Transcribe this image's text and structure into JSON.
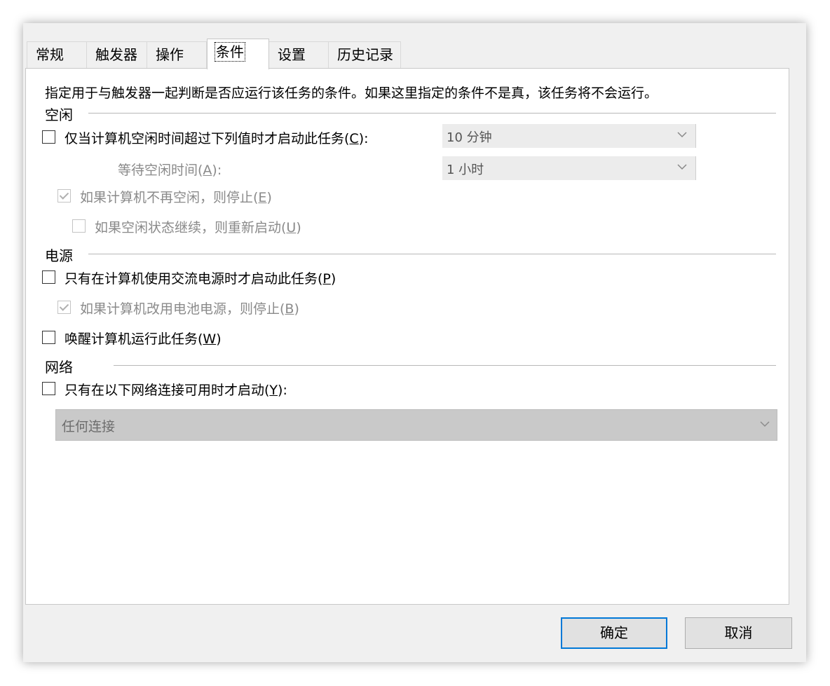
{
  "tabs": [
    {
      "label": "常规"
    },
    {
      "label": "触发器"
    },
    {
      "label": "操作"
    },
    {
      "label": "条件"
    },
    {
      "label": "设置"
    },
    {
      "label": "历史记录"
    }
  ],
  "active_tab": "条件",
  "description": "指定用于与触发器一起判断是否应运行该任务的条件。如果这里指定的条件不是真，该任务将不会运行。",
  "idle": {
    "title": "空闲",
    "start_if_idle": {
      "text": "仅当计算机空闲时间超过下列值时才启动此任务(",
      "key": "C",
      "suffix": "):",
      "checked": false
    },
    "idle_duration": {
      "value": "10 分钟"
    },
    "wait_label": {
      "text": "等待空闲时间(",
      "key": "A",
      "suffix": "):"
    },
    "wait_duration": {
      "value": "1 小时"
    },
    "stop_if_not_idle": {
      "text": "如果计算机不再空闲，则停止(",
      "key": "E",
      "suffix": ")",
      "checked": true,
      "enabled": false
    },
    "restart_if_idle": {
      "text": "如果空闲状态继续，则重新启动(",
      "key": "U",
      "suffix": ")",
      "checked": false,
      "enabled": false
    }
  },
  "power": {
    "title": "电源",
    "ac_only": {
      "text": "只有在计算机使用交流电源时才启动此任务(",
      "key": "P",
      "suffix": ")",
      "checked": false
    },
    "stop_on_battery": {
      "text": "如果计算机改用电池电源，则停止(",
      "key": "B",
      "suffix": ")",
      "checked": true,
      "enabled": false
    },
    "wake": {
      "text": "唤醒计算机运行此任务(",
      "key": "W",
      "suffix": ")",
      "checked": false
    }
  },
  "network": {
    "title": "网络",
    "only_if_available": {
      "text": "只有在以下网络连接可用时才启动(",
      "key": "Y",
      "suffix": "):",
      "checked": false
    },
    "connection": {
      "value": "任何连接"
    }
  },
  "buttons": {
    "ok": "确定",
    "cancel": "取消"
  },
  "colors": {
    "dialog_bg": "#f0f0f0",
    "panel_bg": "#ffffff",
    "default_button_border": "#0078d7",
    "disabled_text": "#8a8a8a"
  }
}
